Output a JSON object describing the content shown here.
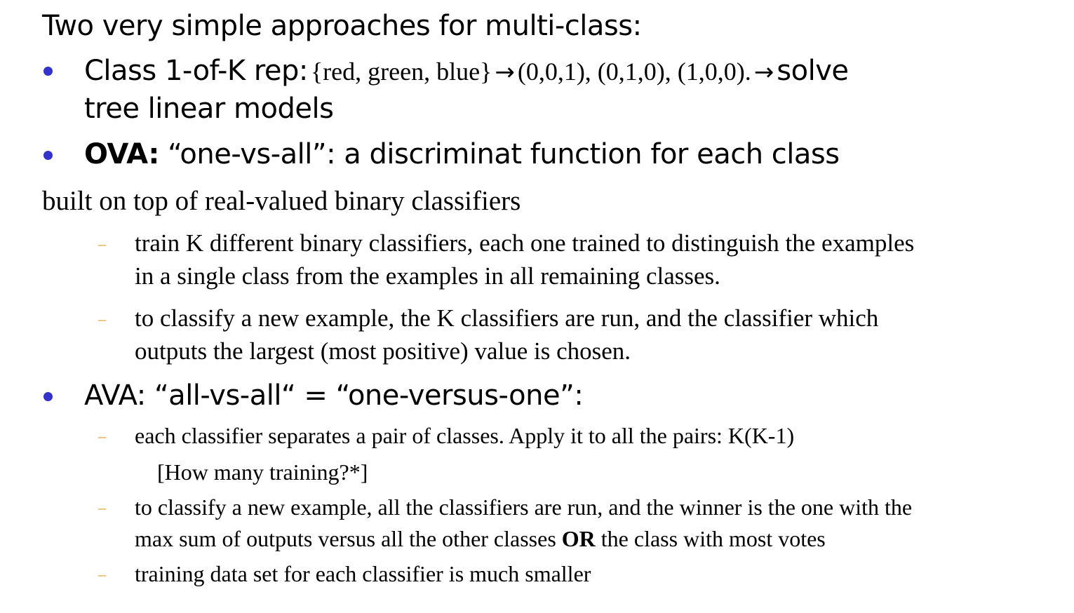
{
  "title": "Two very simple approaches for multi-class:",
  "bullets": {
    "class1ofk": {
      "label": "Class 1-of-K rep:",
      "set": "{red, green, blue}",
      "arrow": "→",
      "codes": "(0,0,1), (0,1,0), (1,0,0).",
      "after": "solve",
      "line2": "tree linear models"
    },
    "ova": {
      "label": "OVA:",
      "text": "“one-vs-all”: a discriminat function for each class"
    },
    "built_on": "built on top of real-valued binary classifiers",
    "ova_sub": [
      {
        "line1": "train K different binary classifiers, each one trained to distinguish the examples",
        "line2": "in a single class from the examples in all remaining classes."
      },
      {
        "line1": "to classify a new example, the K classifiers  are run, and the classifier which",
        "line2": "outputs the largest (most positive) value is chosen."
      }
    ],
    "ava": {
      "text": "AVA: “all-vs-all“ = “one-versus-one”:"
    },
    "ava_sub": [
      {
        "line1": "each classifier separates a pair of classes. Apply it to all the pairs: K(K-1)",
        "line2": "[How many training?*]"
      },
      {
        "line1": "to classify a new example,  all the classifiers  are run, and the winner is the one with the",
        "line2_a": "max sum of outputs versus all the other classes",
        "line2_bold": "OR",
        "line2_b": "the class with most votes"
      },
      {
        "line1": "training data set for each classifier is much smaller"
      }
    ]
  },
  "colors": {
    "bullet": "#3333cc",
    "dash": "#e69a1f"
  }
}
